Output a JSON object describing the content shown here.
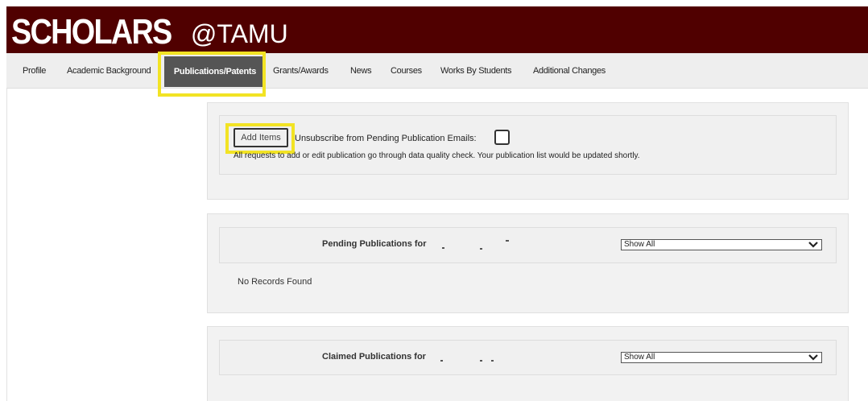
{
  "header": {
    "logo_main": "SCHOLARS",
    "logo_at": "@TAMU"
  },
  "nav": {
    "items": [
      {
        "label": "Profile"
      },
      {
        "label": "Academic Background"
      },
      {
        "label": "Publications/Patents",
        "active": true
      },
      {
        "label": "Grants/Awards"
      },
      {
        "label": "News"
      },
      {
        "label": "Courses"
      },
      {
        "label": "Works By Students"
      },
      {
        "label": "Additional Changes"
      }
    ]
  },
  "actions": {
    "add_items_label": "Add Items",
    "unsubscribe_label": "Unsubscribe from Pending Publication Emails:",
    "unsubscribe_checked": false,
    "info_text": "All requests to add or edit publication go through data quality check. Your publication list would be updated shortly."
  },
  "pending": {
    "label": "Pending Publications for",
    "filter_value": "Show All",
    "empty_text": "No Records Found"
  },
  "claimed": {
    "label": "Claimed Publications for",
    "filter_value": "Show All"
  },
  "colors": {
    "brand_maroon": "#500000",
    "highlight_yellow": "#f2e324",
    "active_tab": "#555555"
  }
}
